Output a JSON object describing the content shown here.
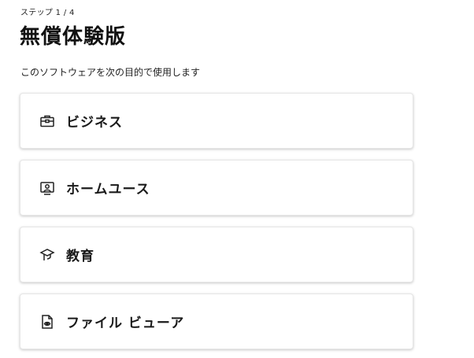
{
  "header": {
    "step_text": "ステップ 1 / 4",
    "title": "無償体験版",
    "subtitle": "このソフトウェアを次の目的で使用します"
  },
  "options": [
    {
      "label": "ビジネス",
      "icon": "briefcase-icon"
    },
    {
      "label": "ホームユース",
      "icon": "home-user-icon"
    },
    {
      "label": "教育",
      "icon": "graduation-cap-icon"
    },
    {
      "label": "ファイル ビューア",
      "icon": "file-view-icon"
    }
  ]
}
